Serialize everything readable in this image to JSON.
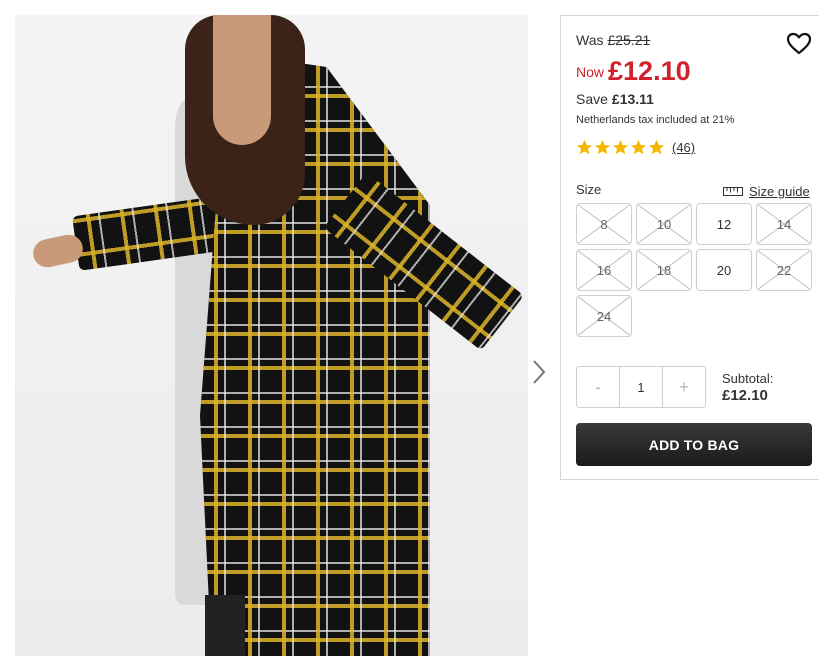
{
  "pricing": {
    "was_label": "Was",
    "was_price": "£25.21",
    "now_label": "Now",
    "now_price": "£12.10",
    "save_label": "Save",
    "save_amount": "£13.11",
    "tax_note": "Netherlands tax included at 21%"
  },
  "rating": {
    "stars": 5,
    "review_count": "(46)",
    "star_color": "#f5b800"
  },
  "size_section": {
    "label": "Size",
    "guide_label": "Size guide",
    "sizes": [
      {
        "label": "8",
        "available": false
      },
      {
        "label": "10",
        "available": false
      },
      {
        "label": "12",
        "available": true
      },
      {
        "label": "14",
        "available": false
      },
      {
        "label": "16",
        "available": false
      },
      {
        "label": "18",
        "available": false
      },
      {
        "label": "20",
        "available": true
      },
      {
        "label": "22",
        "available": false
      },
      {
        "label": "24",
        "available": false
      }
    ]
  },
  "quantity": {
    "minus": "-",
    "value": "1",
    "plus": "+"
  },
  "subtotal": {
    "label": "Subtotal:",
    "amount": "£12.10"
  },
  "cta": {
    "add_to_bag": "ADD TO BAG"
  },
  "icons": {
    "wishlist": "heart-icon",
    "next": "chevron-right-icon",
    "size_guide": "ruler-icon"
  },
  "colors": {
    "price_red": "#d0212b",
    "button_dark": "#1f1f1f"
  }
}
